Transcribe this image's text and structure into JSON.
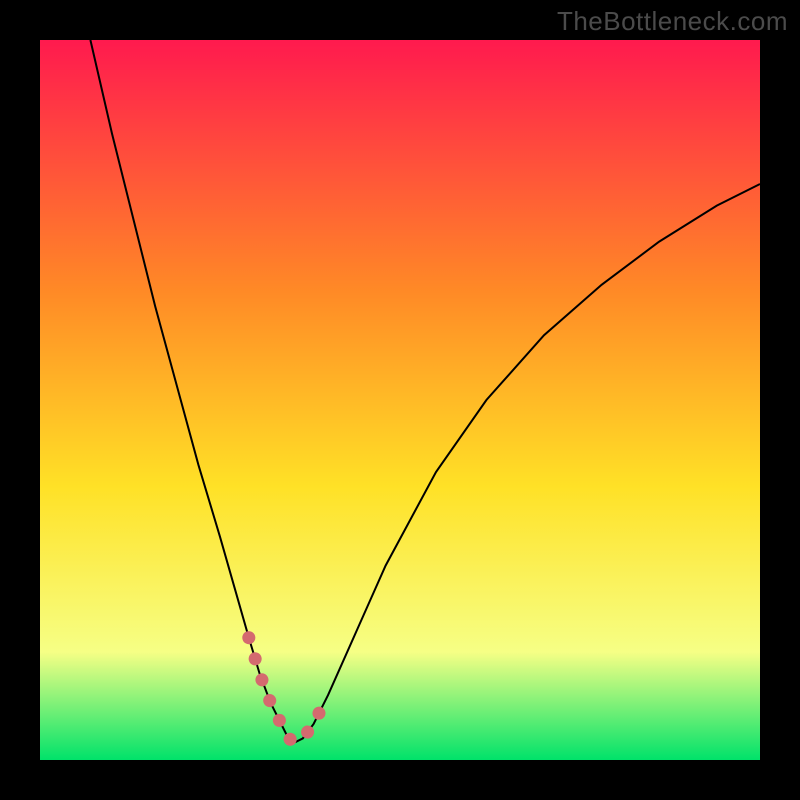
{
  "watermark": "TheBottleneck.com",
  "chart_data": {
    "type": "line",
    "title": "",
    "xlabel": "",
    "ylabel": "",
    "xlim": [
      0,
      100
    ],
    "ylim": [
      0,
      100
    ],
    "grid": false,
    "legend": false,
    "colors": {
      "top": "#ff1a4e",
      "mid_upper": "#ff8a26",
      "mid": "#ffe126",
      "mid_lower": "#f6ff85",
      "bottom": "#00e26a"
    },
    "series": [
      {
        "name": "curve",
        "stroke": "#000000",
        "stroke_width": 2,
        "x": [
          7,
          10,
          13,
          16,
          19,
          22,
          25,
          27,
          29,
          30.5,
          32,
          33.5,
          34.5,
          35.5,
          36.5,
          38,
          40,
          44,
          48,
          55,
          62,
          70,
          78,
          86,
          94,
          100
        ],
        "y": [
          100,
          87,
          75,
          63,
          52,
          41,
          31,
          24,
          17,
          12,
          8,
          5,
          3,
          2.5,
          3,
          5,
          9,
          18,
          27,
          40,
          50,
          59,
          66,
          72,
          77,
          80
        ]
      },
      {
        "name": "highlight",
        "stroke": "#d46a6f",
        "stroke_width": 13,
        "linecap": "round",
        "dash": "0.1 22",
        "x": [
          29,
          30.5,
          32,
          33.5,
          34.5,
          35.5,
          36.5,
          38,
          40
        ],
        "y": [
          17,
          12,
          8,
          5,
          3,
          2.5,
          3,
          5,
          9
        ]
      }
    ]
  }
}
